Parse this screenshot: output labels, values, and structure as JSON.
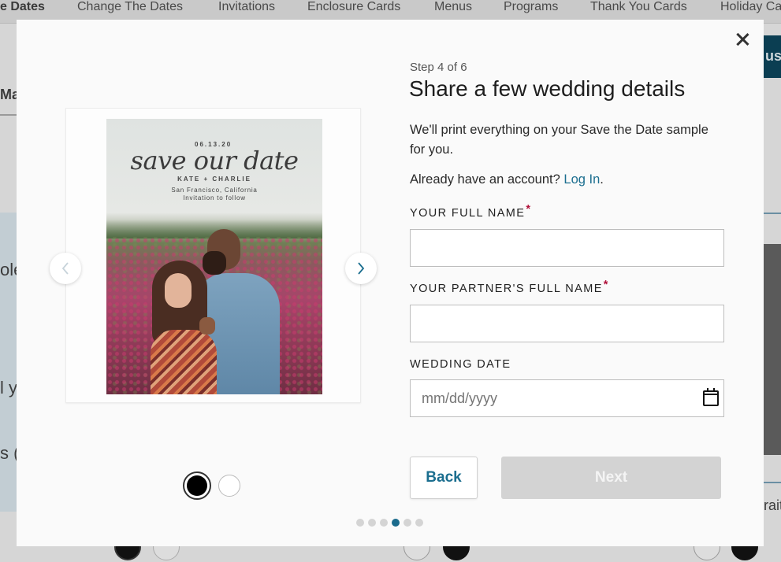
{
  "background": {
    "nav_items": [
      {
        "label": "e Dates",
        "active": true
      },
      {
        "label": "Change The Dates",
        "active": false
      },
      {
        "label": "Invitations",
        "active": false
      },
      {
        "label": "Enclosure Cards",
        "active": false
      },
      {
        "label": "Menus",
        "active": false
      },
      {
        "label": "Programs",
        "active": false
      },
      {
        "label": "Thank You Cards",
        "active": false
      },
      {
        "label": "Holiday Ca",
        "active": false
      }
    ],
    "tab_fragment": "Ma",
    "left_fragments": [
      "ole",
      "l y",
      "s ("
    ],
    "right_button_fragment": "ust",
    "right_fragment": "rait"
  },
  "modal": {
    "close_icon": "close-icon",
    "preview": {
      "card_date": "06.13.20",
      "card_script": "save our date",
      "card_names": "KATE + CHARLIE",
      "card_location": "San Francisco, California",
      "card_followup": "Invitation to follow",
      "prev_icon": "chevron-left-icon",
      "next_icon": "chevron-right-icon",
      "color_options": [
        {
          "name": "black",
          "color": "#000000",
          "selected": true
        },
        {
          "name": "white",
          "color": "#ffffff",
          "selected": false
        }
      ]
    },
    "progress": {
      "total": 6,
      "current": 4
    },
    "form": {
      "step_label": "Step 4 of 6",
      "title": "Share a few wedding details",
      "description": "We'll print everything on your Save the Date sample for you.",
      "account_prompt": "Already have an account?",
      "login_link": "Log In",
      "login_suffix": ".",
      "fields": {
        "full_name": {
          "label": "YOUR FULL NAME",
          "required_mark": "*",
          "value": ""
        },
        "partner_name": {
          "label": "YOUR PARTNER'S FULL NAME",
          "required_mark": "*",
          "value": ""
        },
        "wedding_date": {
          "label": "WEDDING DATE",
          "placeholder": "mm/dd/yyyy",
          "value": ""
        }
      },
      "back_label": "Back",
      "next_label": "Next"
    }
  },
  "colors": {
    "accent": "#1b6e8f",
    "required": "#b0123a",
    "disabled_button": "#d3d3d3"
  }
}
